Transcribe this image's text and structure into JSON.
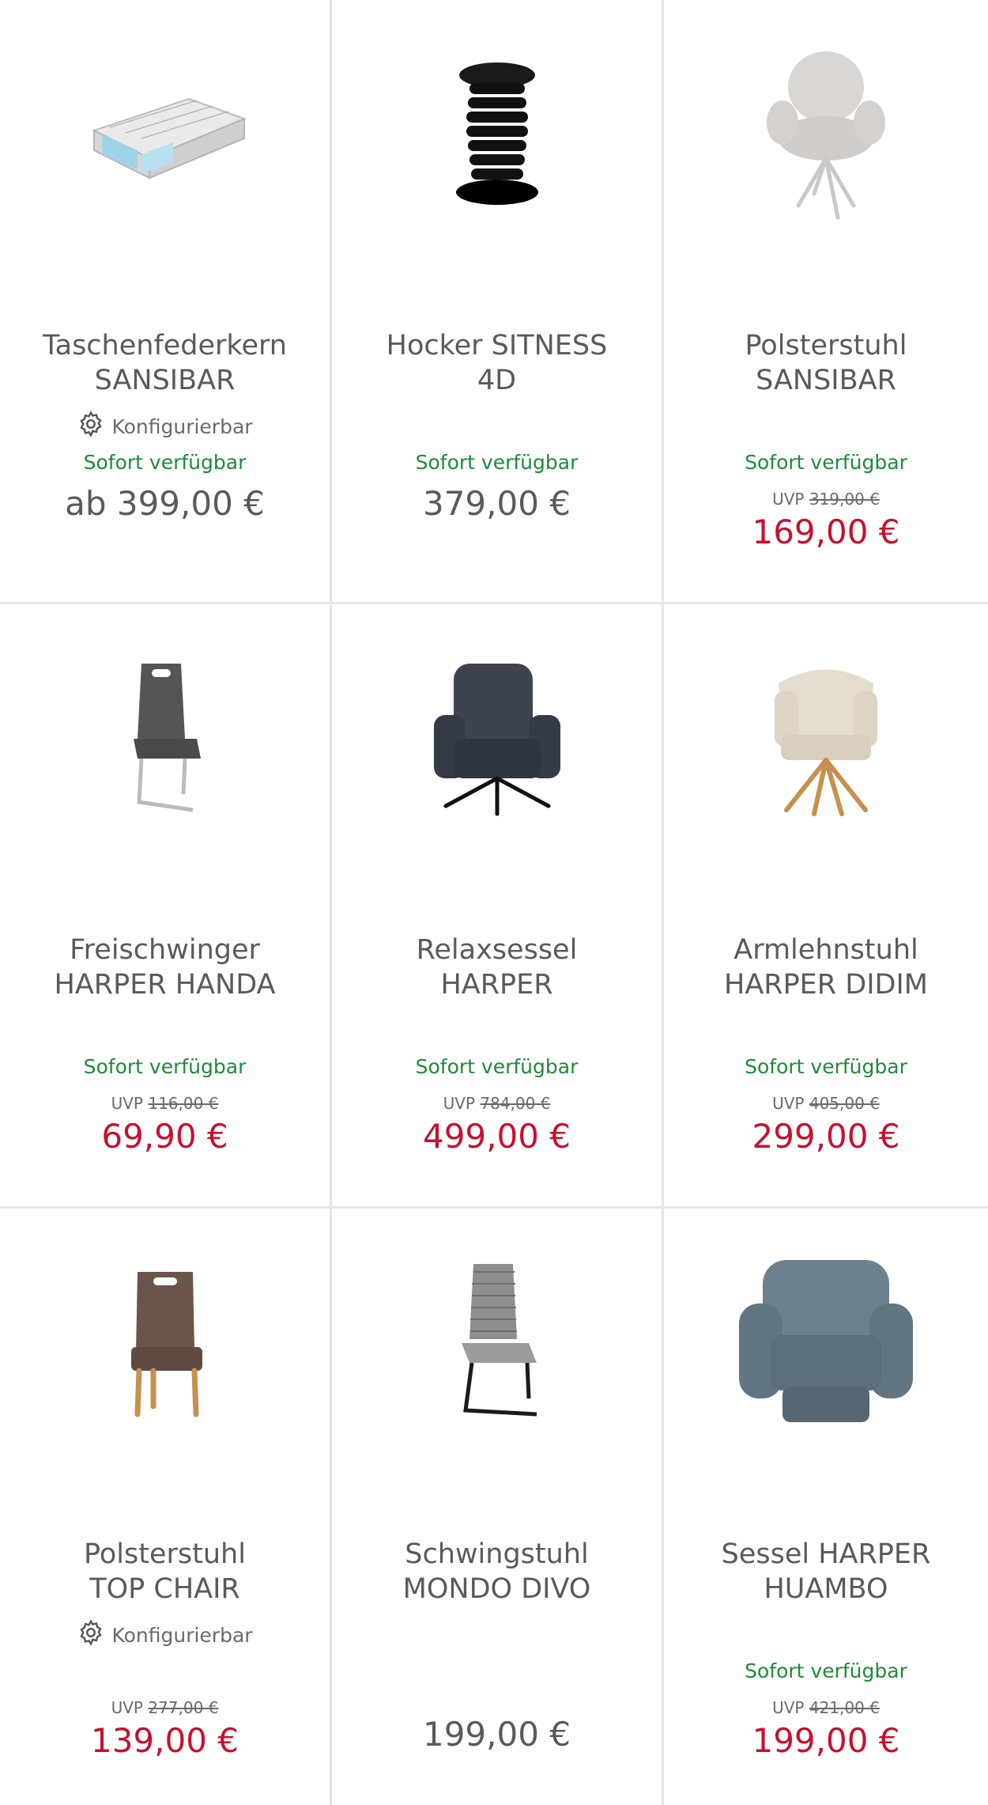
{
  "colors": {
    "available": "#1e8a3a",
    "sale": "#c8102e",
    "text": "#5a5a5a"
  },
  "labels": {
    "configurable": "Konfigurierbar",
    "uvp": "UVP"
  },
  "products": [
    {
      "name_line1": "Taschenfederkern",
      "name_line2": "SANSIBAR",
      "configurable": true,
      "availability": "Sofort verfügbar",
      "uvp": "",
      "price": "ab 399,00 €",
      "sale": false,
      "icon": "mattress-image"
    },
    {
      "name_line1": "Hocker SITNESS",
      "name_line2": "4D",
      "configurable": false,
      "availability": "Sofort verfügbar",
      "uvp": "",
      "price": "379,00 €",
      "sale": false,
      "icon": "stool-image"
    },
    {
      "name_line1": "Polsterstuhl",
      "name_line2": "SANSIBAR",
      "configurable": false,
      "availability": "Sofort verfügbar",
      "uvp": "319,00 €",
      "price": "169,00 €",
      "sale": true,
      "icon": "swivel-chair-image"
    },
    {
      "name_line1": "Freischwinger",
      "name_line2": "HARPER HANDA",
      "configurable": false,
      "availability": "Sofort verfügbar",
      "uvp": "116,00 €",
      "price": "69,90 €",
      "sale": true,
      "icon": "cantilever-chair-image"
    },
    {
      "name_line1": "Relaxsessel",
      "name_line2": "HARPER",
      "configurable": false,
      "availability": "Sofort verfügbar",
      "uvp": "784,00 €",
      "price": "499,00 €",
      "sale": true,
      "icon": "recliner-image"
    },
    {
      "name_line1": "Armlehnstuhl",
      "name_line2": "HARPER DIDIM",
      "configurable": false,
      "availability": "Sofort verfügbar",
      "uvp": "405,00 €",
      "price": "299,00 €",
      "sale": true,
      "icon": "armchair-image"
    },
    {
      "name_line1": "Polsterstuhl",
      "name_line2": "TOP CHAIR",
      "configurable": true,
      "availability": "",
      "uvp": "277,00 €",
      "price": "139,00 €",
      "sale": true,
      "icon": "upholstered-chair-image"
    },
    {
      "name_line1": "Schwingstuhl",
      "name_line2": "MONDO DIVO",
      "configurable": false,
      "availability": "",
      "uvp": "",
      "price": "199,00 €",
      "sale": false,
      "icon": "swing-chair-image"
    },
    {
      "name_line1": "Sessel HARPER",
      "name_line2": "HUAMBO",
      "configurable": false,
      "availability": "Sofort verfügbar",
      "uvp": "421,00 €",
      "price": "199,00 €",
      "sale": true,
      "icon": "sofa-recliner-image"
    }
  ]
}
